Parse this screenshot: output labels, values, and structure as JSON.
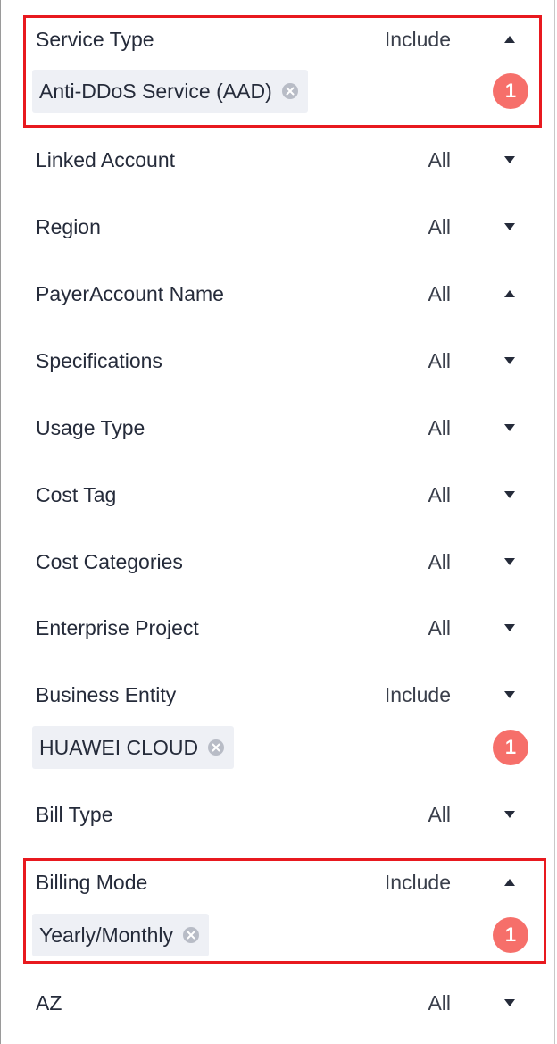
{
  "filters": [
    {
      "label": "Service Type",
      "value": "Include",
      "arrow": "up",
      "chip": "Anti-DDoS Service (AAD)",
      "badge": "1"
    },
    {
      "label": "Linked Account",
      "value": "All",
      "arrow": "down"
    },
    {
      "label": "Region",
      "value": "All",
      "arrow": "down"
    },
    {
      "label": "PayerAccount Name",
      "value": "All",
      "arrow": "up"
    },
    {
      "label": "Specifications",
      "value": "All",
      "arrow": "down"
    },
    {
      "label": "Usage Type",
      "value": "All",
      "arrow": "down"
    },
    {
      "label": "Cost Tag",
      "value": "All",
      "arrow": "down"
    },
    {
      "label": "Cost Categories",
      "value": "All",
      "arrow": "down"
    },
    {
      "label": "Enterprise Project",
      "value": "All",
      "arrow": "down"
    },
    {
      "label": "Business Entity",
      "value": "Include",
      "arrow": "down",
      "chip": "HUAWEI CLOUD",
      "badge": "1"
    },
    {
      "label": "Bill Type",
      "value": "All",
      "arrow": "down"
    },
    {
      "label": "Billing Mode",
      "value": "Include",
      "arrow": "up",
      "chip": "Yearly/Monthly",
      "badge": "1"
    },
    {
      "label": "AZ",
      "value": "All",
      "arrow": "down"
    }
  ],
  "icons": {
    "arrow_up": "caret-up-icon",
    "arrow_down": "caret-down-icon",
    "chip_close": "clear-icon"
  },
  "colors": {
    "highlight": "#e8191f",
    "badge": "#f66f6a",
    "chip_bg": "#eef0f5"
  }
}
